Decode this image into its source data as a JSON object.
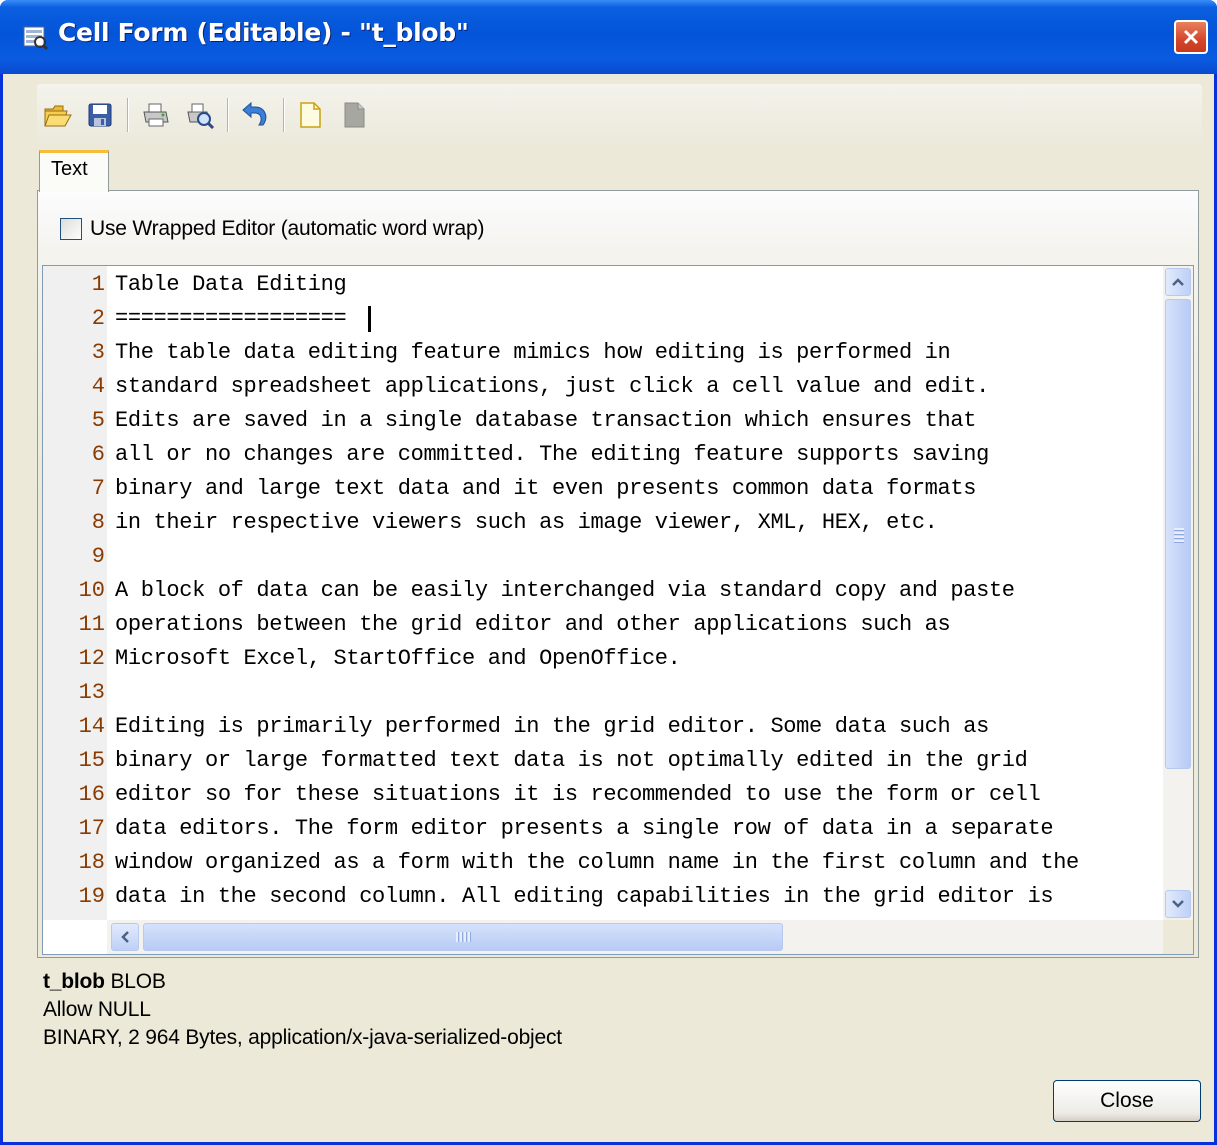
{
  "window": {
    "title": "Cell Form (Editable) - \"t_blob\"",
    "title_icon": "form-icon",
    "close_icon": "close-icon"
  },
  "toolbar": {
    "buttons": [
      {
        "icon": "open-folder-icon"
      },
      {
        "icon": "save-icon"
      },
      {
        "icon": "print-icon"
      },
      {
        "icon": "print-preview-icon"
      },
      {
        "icon": "undo-icon"
      },
      {
        "icon": "new-document-icon"
      },
      {
        "icon": "clear-document-icon"
      }
    ]
  },
  "tabs": [
    {
      "label": "Text",
      "active": true
    }
  ],
  "wrap_option": {
    "label": "Use Wrapped Editor (automatic word wrap)",
    "checked": false
  },
  "editor": {
    "lines": [
      {
        "n": "1",
        "text": "Table Data Editing"
      },
      {
        "n": "2",
        "text": "=================="
      },
      {
        "n": "3",
        "text": "The table data editing feature mimics how editing is performed in"
      },
      {
        "n": "4",
        "text": "standard spreadsheet applications, just click a cell value and edit."
      },
      {
        "n": "5",
        "text": "Edits are saved in a single database transaction which ensures that"
      },
      {
        "n": "6",
        "text": "all or no changes are committed. The editing feature supports saving"
      },
      {
        "n": "7",
        "text": "binary and large text data and it even presents common data formats"
      },
      {
        "n": "8",
        "text": "in their respective viewers such as image viewer, XML, HEX, etc."
      },
      {
        "n": "9",
        "text": ""
      },
      {
        "n": "10",
        "text": "A block of data can be easily interchanged via standard copy and paste"
      },
      {
        "n": "11",
        "text": "operations between the grid editor and other applications such as"
      },
      {
        "n": "12",
        "text": "Microsoft Excel, StartOffice and OpenOffice."
      },
      {
        "n": "13",
        "text": ""
      },
      {
        "n": "14",
        "text": "Editing is primarily performed in the grid editor. Some data such as"
      },
      {
        "n": "15",
        "text": "binary or large formatted text data is not optimally edited in the grid"
      },
      {
        "n": "16",
        "text": "editor so for these situations it is recommended to use the form or cell"
      },
      {
        "n": "17",
        "text": "data editors. The form editor presents a single row of data in a separate"
      },
      {
        "n": "18",
        "text": "window organized as a form with the column name in the first column and the"
      },
      {
        "n": "19",
        "text": "data in the second column. All editing capabilities in the grid editor is"
      }
    ]
  },
  "column_info": {
    "name": "t_blob",
    "type": "BLOB",
    "nullability": "Allow NULL",
    "details": "BINARY, 2 964 Bytes, application/x-java-serialized-object"
  },
  "buttons": {
    "close": "Close"
  },
  "colors": {
    "title_bar": "#0454d8",
    "window_bg": "#ece9d8",
    "line_number": "#8a3b00",
    "close_red": "#d5462a"
  }
}
